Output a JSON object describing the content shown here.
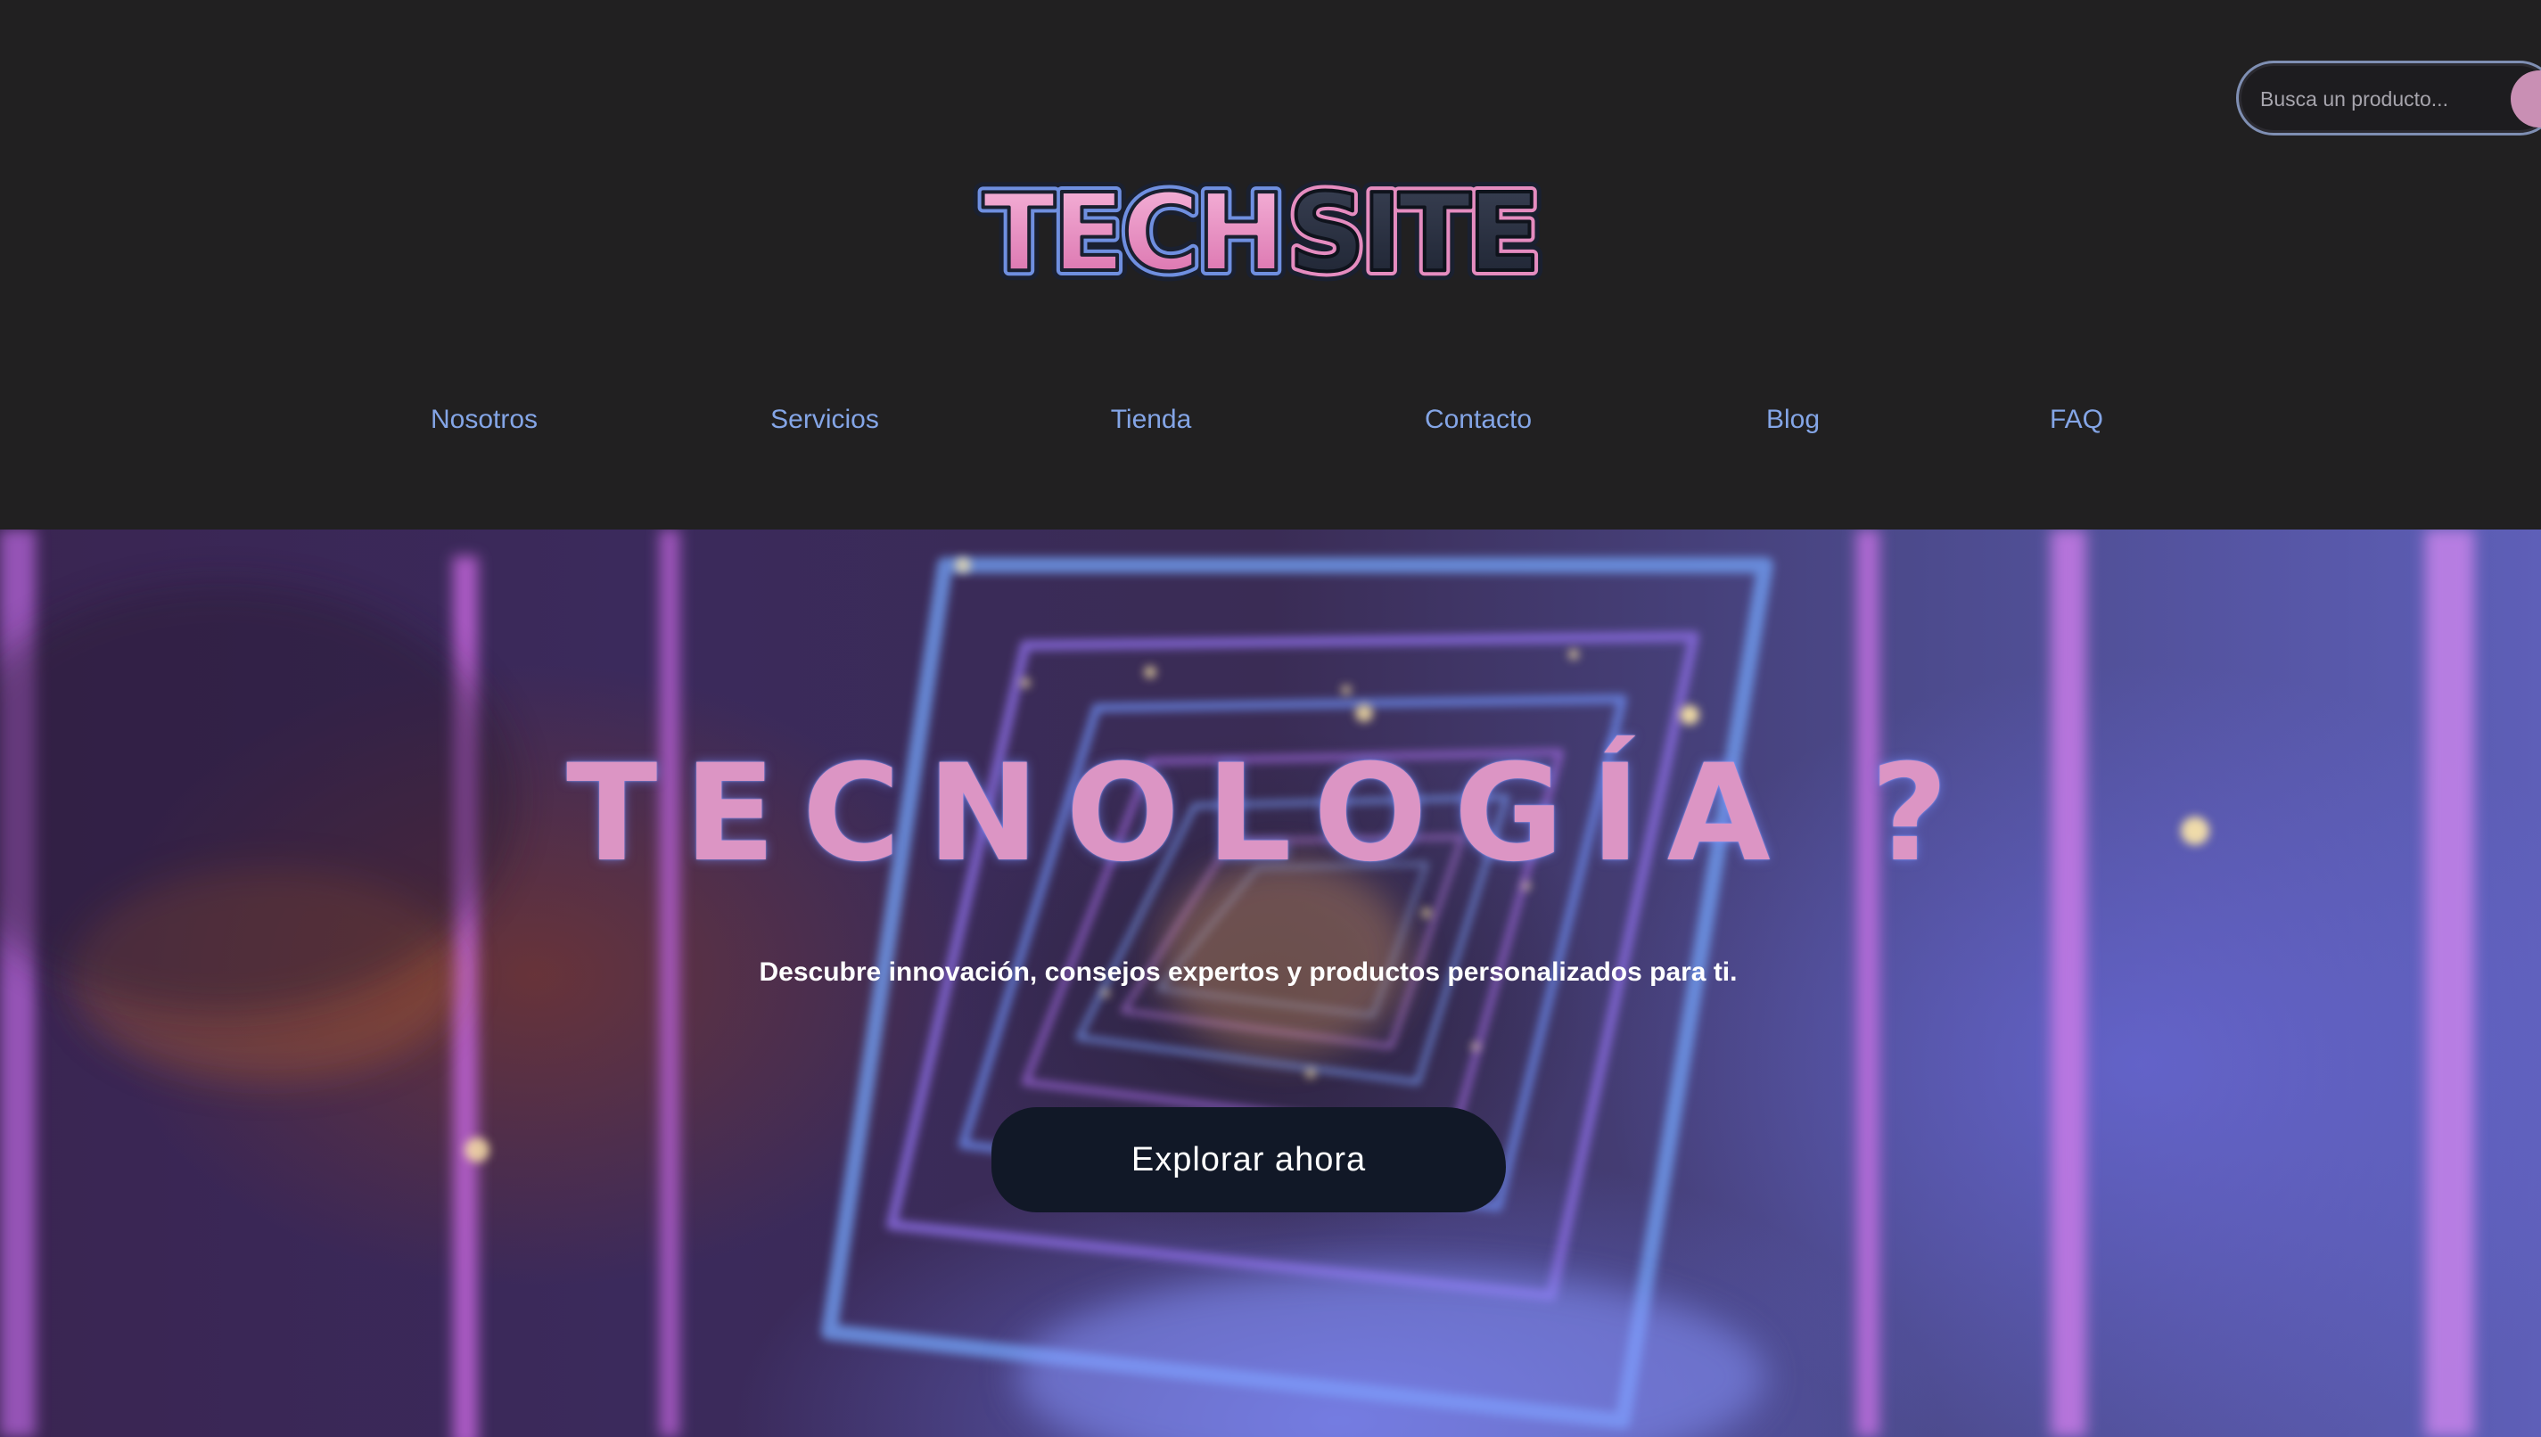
{
  "header": {
    "logo_text": "TECHSITE",
    "search": {
      "placeholder": "Busca un producto..."
    },
    "nav": [
      {
        "label": "Nosotros"
      },
      {
        "label": "Servicios"
      },
      {
        "label": "Tienda"
      },
      {
        "label": "Contacto"
      },
      {
        "label": "Blog"
      },
      {
        "label": "FAQ"
      }
    ]
  },
  "hero": {
    "title": "TECNOLOGÍA ?",
    "subtitle": "Descubre innovación, consejos expertos y productos personalizados para ti.",
    "cta_label": "Explorar ahora"
  },
  "colors": {
    "background": "#212021",
    "nav_link": "#84a5e6",
    "accent_pink": "#dc95c4",
    "button_dark": "#111827"
  },
  "icons": {
    "search_button": "search-icon"
  }
}
